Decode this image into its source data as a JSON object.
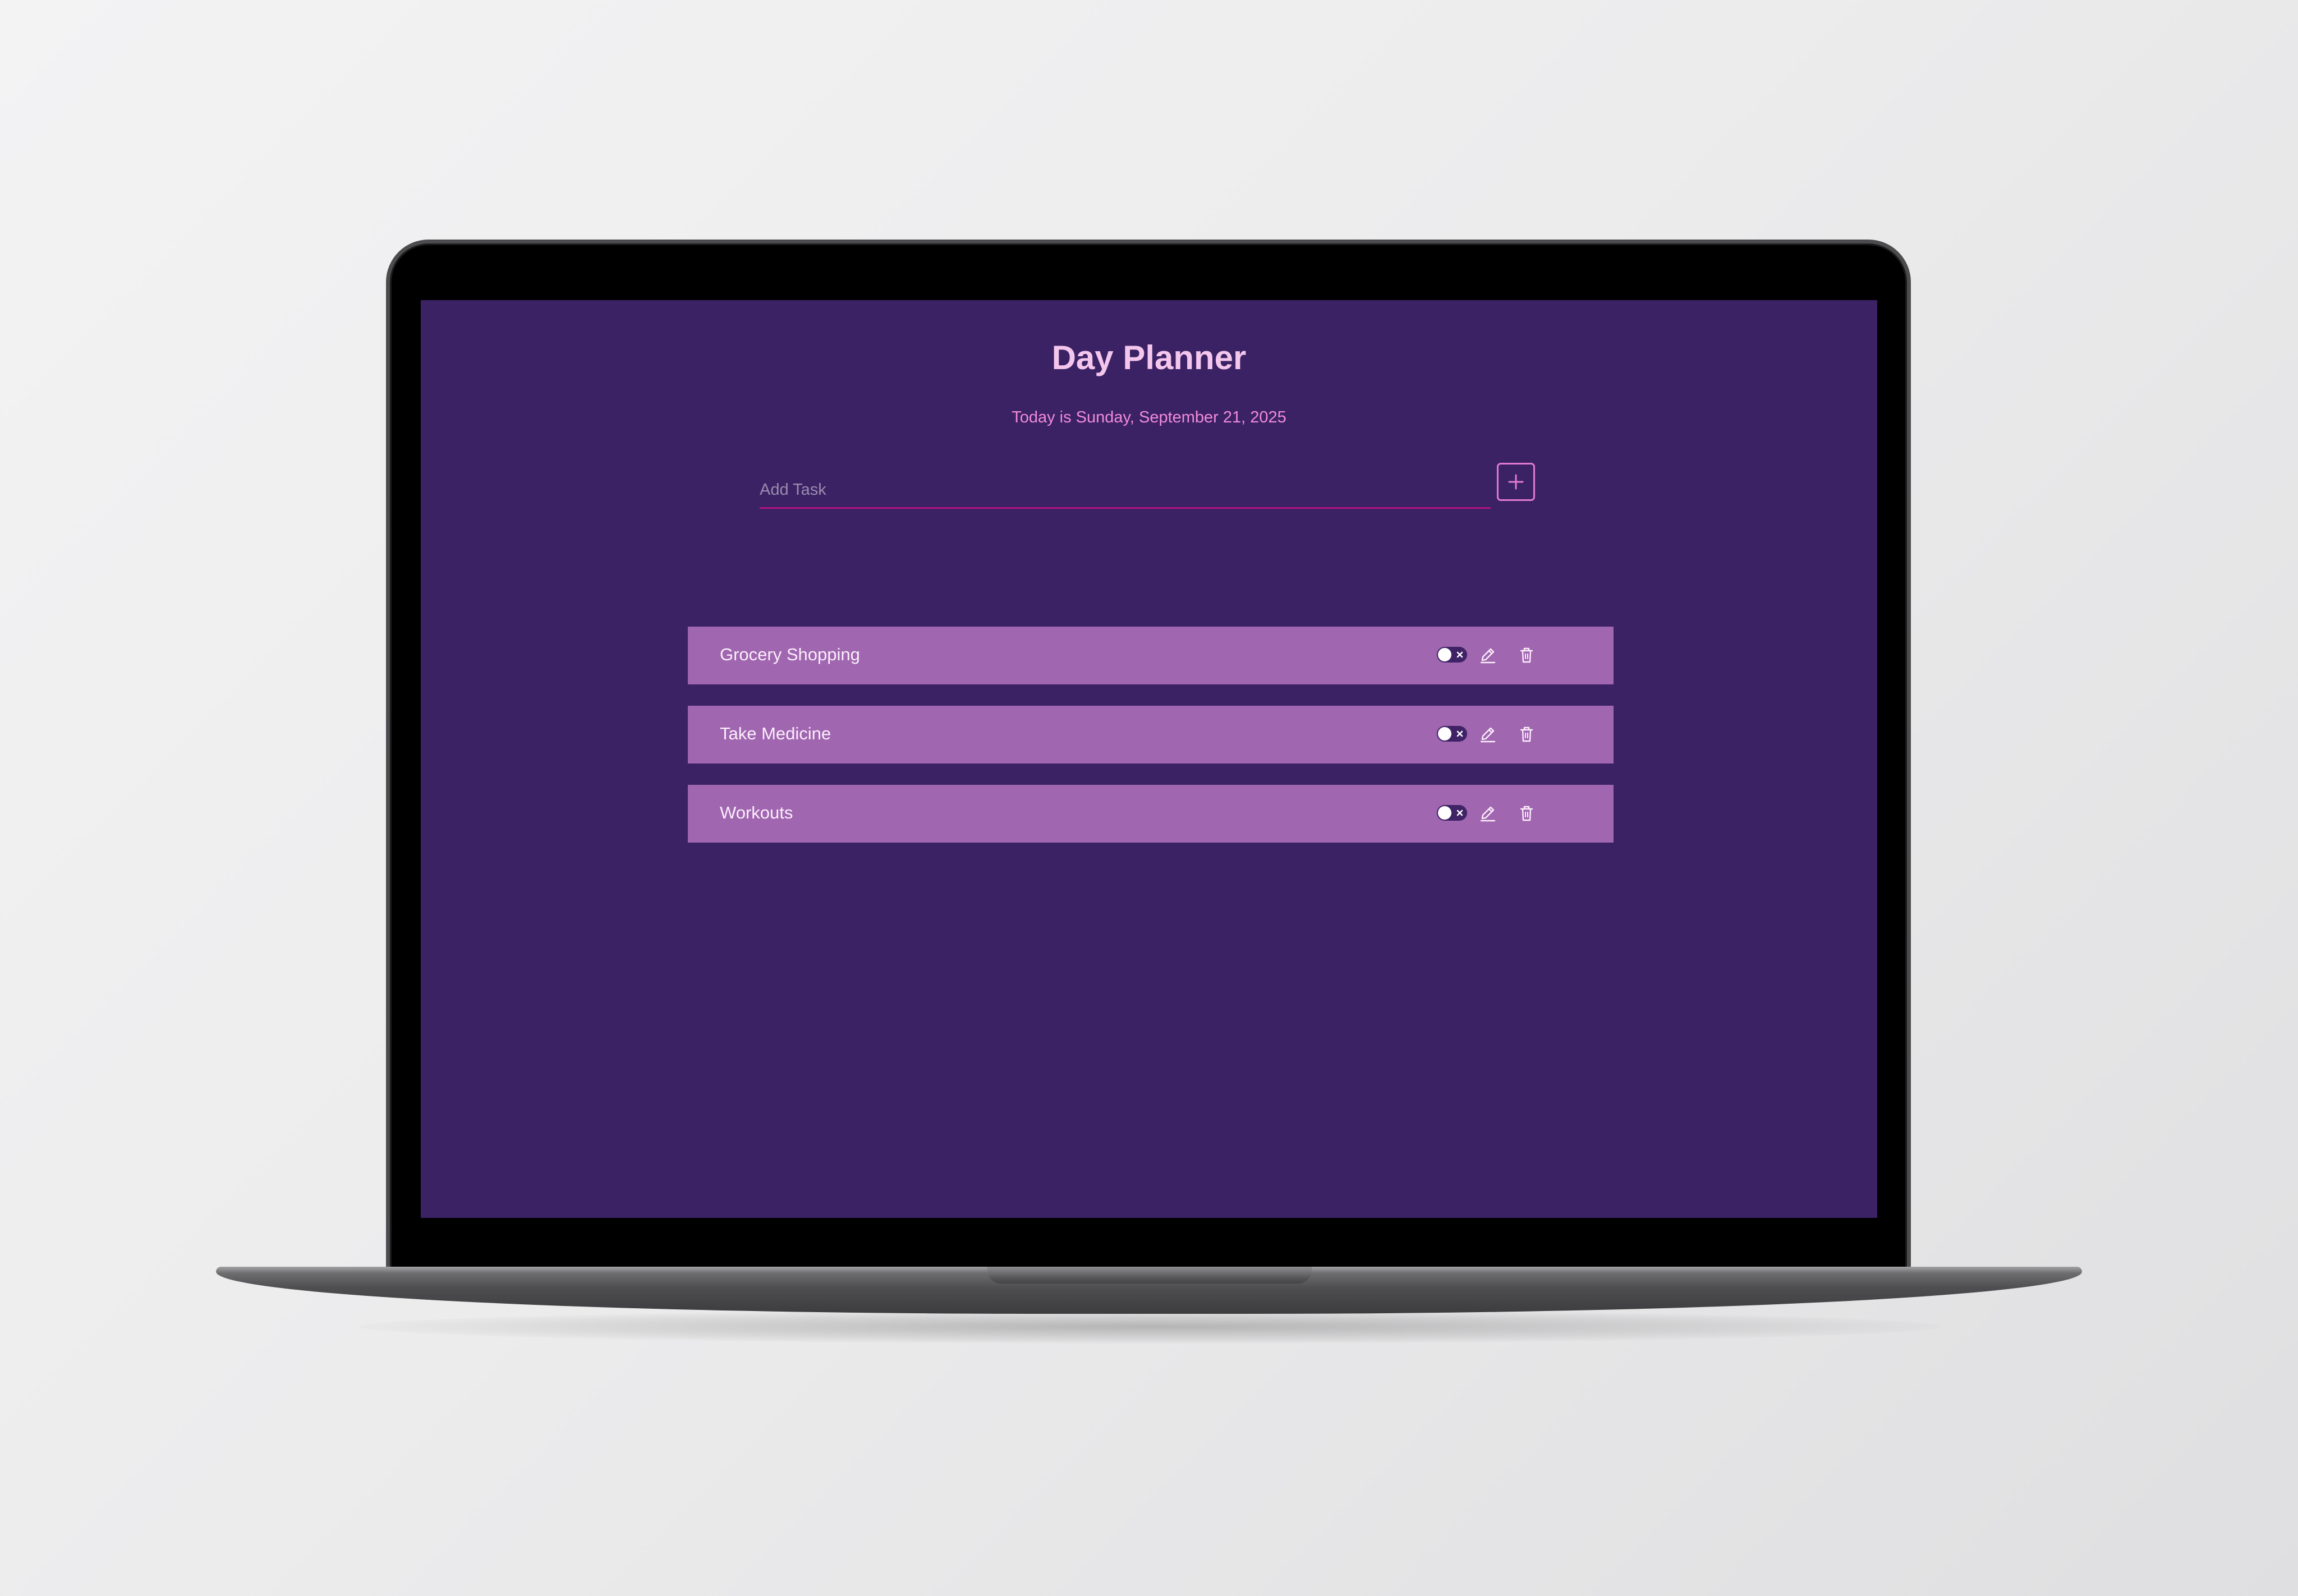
{
  "app": {
    "title": "Day Planner",
    "date_text": "Today is Sunday, September 21, 2025"
  },
  "add_task": {
    "placeholder": "Add Task",
    "value": "",
    "button_icon": "plus-icon"
  },
  "tasks": [
    {
      "label": "Grocery Shopping",
      "completed": false
    },
    {
      "label": "Take Medicine",
      "completed": false
    },
    {
      "label": "Workouts",
      "completed": false
    }
  ],
  "icons": {
    "toggle": "toggle-switch-off",
    "edit": "pencil-icon",
    "delete": "trash-icon"
  },
  "colors": {
    "screen_background": "#3a2265",
    "title": "#f4c6ec",
    "date_text": "#f28ad9",
    "input_underline": "#b0147f",
    "add_button_border": "#e27ad0",
    "task_background": "#a066b0",
    "task_text": "#fbeefb",
    "toggle_track": "#3f2366"
  }
}
